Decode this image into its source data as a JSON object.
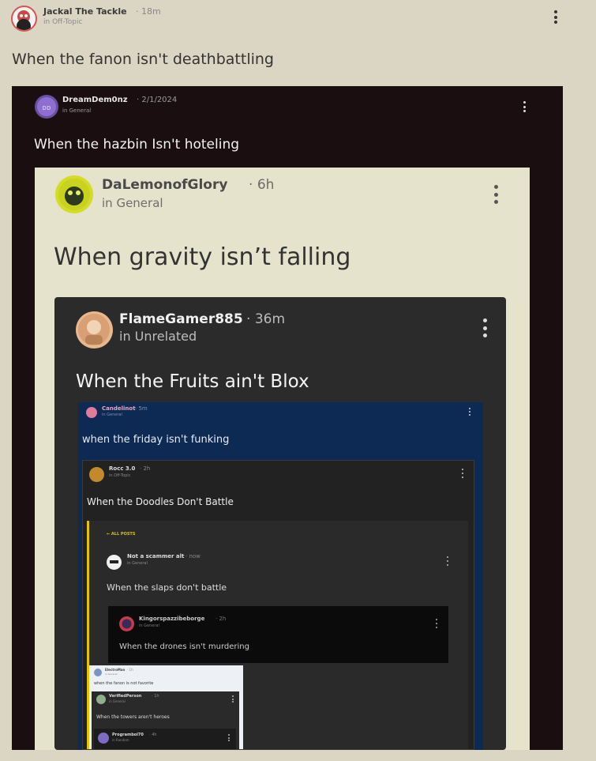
{
  "post": {
    "author": "Jackal The Tackle",
    "time": "18m",
    "category": "in Off-Topic",
    "text": "When the fanon isn't deathbattling"
  },
  "quotes": [
    {
      "author": "DreamDem0nz",
      "time": "2/1/2024",
      "category": "in General",
      "text": "When the hazbin Isn't hoteling"
    },
    {
      "author": "DaLemonofGlory",
      "time": "6h",
      "category": "in General",
      "text": "When gravity isn’t falling"
    },
    {
      "author": "FlameGamer885",
      "time": "36m",
      "category": "in Unrelated",
      "text": "When the Fruits ain't Blox"
    },
    {
      "author": "Candelinot",
      "time": "5m",
      "category": "in General",
      "text": "when the friday isn't funking"
    },
    {
      "author": "Rocc 3.0",
      "time": "2h",
      "category": "in Off-Topic",
      "text": "When the Doodles Don't Battle"
    },
    {
      "back_label": "← ALL POSTS",
      "author": "Not a scammer alt",
      "time": "now",
      "category": "in General",
      "text": "When the slaps don't battle"
    },
    {
      "author": "Kingorspazzibeborge",
      "time": "2h",
      "category": "in General",
      "text": "When the drones isn't murdering"
    },
    {
      "author": "ElectroMan",
      "time": "1h",
      "category": "in General",
      "text": "when the fanon is not favorite"
    },
    {
      "author": "VerifiedPerson",
      "time": "1h",
      "category": "in General",
      "text": "When the towers aren't heroes"
    },
    {
      "author": "Programbol70",
      "time": "4h",
      "category": "in Random",
      "text": ""
    }
  ]
}
